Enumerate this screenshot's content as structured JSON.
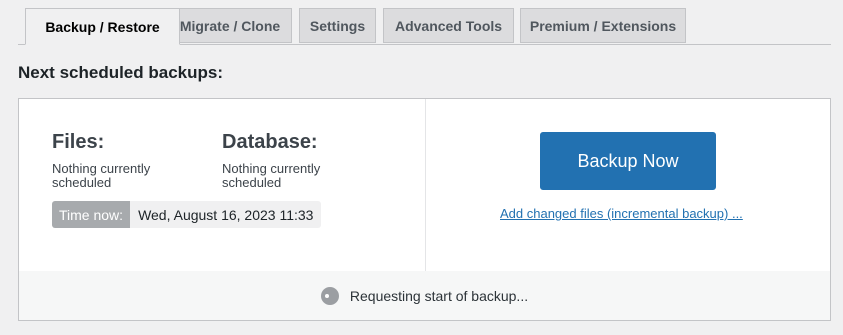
{
  "tabs": [
    {
      "label": "Backup / Restore",
      "active": true
    },
    {
      "label": "Migrate / Clone",
      "active": false
    },
    {
      "label": "Settings",
      "active": false
    },
    {
      "label": "Advanced Tools",
      "active": false
    },
    {
      "label": "Premium / Extensions",
      "active": false
    }
  ],
  "heading": "Next scheduled backups:",
  "files": {
    "title": "Files:",
    "status": "Nothing currently scheduled"
  },
  "database": {
    "title": "Database:",
    "status": "Nothing currently scheduled"
  },
  "time": {
    "label": "Time now:",
    "value": "Wed, August 16, 2023 11:33"
  },
  "actions": {
    "backup_now": "Backup Now",
    "incremental_link": "Add changed files (incremental backup) ..."
  },
  "status": {
    "message": "Requesting start of backup..."
  },
  "colors": {
    "accent": "#2271b1",
    "background": "#f0f0f1"
  }
}
